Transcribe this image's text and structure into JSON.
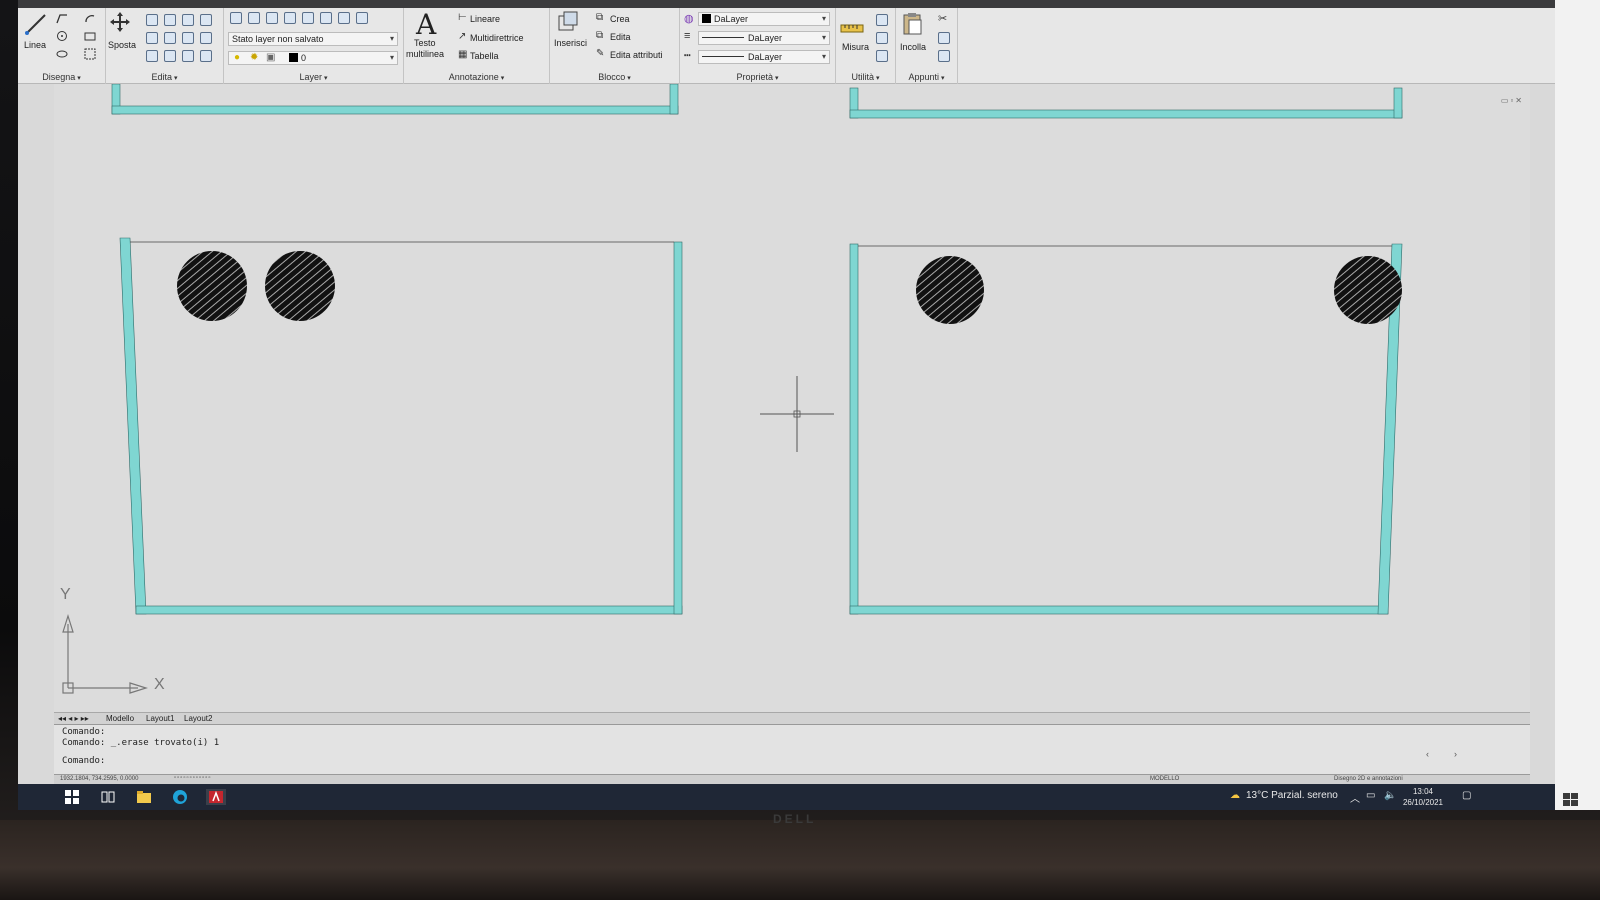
{
  "ribbon": {
    "panels": {
      "disegna": "Disegna",
      "edita": "Edita",
      "layer": "Layer",
      "annotazione": "Annotazione",
      "blocco": "Blocco",
      "proprieta": "Proprietà",
      "utilita": "Utilità",
      "appunti": "Appunti"
    },
    "tools": {
      "linea": "Linea",
      "sposta": "Sposta",
      "layer_state": "Stato layer non salvato",
      "layer_current": "0",
      "testo": "Testo",
      "multilinea": "multilinea",
      "lineare": "Lineare",
      "multidirettrice": "Multidirettrice",
      "tabella": "Tabella",
      "inserisci": "Inserisci",
      "crea": "Crea",
      "edita_block": "Edita",
      "edita_attributi": "Edita attributi",
      "color": "DaLayer",
      "lineweight": "DaLayer",
      "linetype": "DaLayer",
      "misura": "Misura",
      "incolla": "Incolla"
    }
  },
  "drawing": {
    "ucs_x": "X",
    "ucs_y": "Y",
    "stroke_color": "#7fd6d2"
  },
  "tabs": [
    "Modello",
    "Layout1",
    "Layout2"
  ],
  "command": {
    "line1": "Comando:",
    "line2": "Comando: _.erase trovato(i) 1",
    "prompt": "Comando:"
  },
  "status": {
    "coords": "1932.1804, 734.2595, 0.0000",
    "mode": "MODELLO",
    "workspace": "Disegno 2D e annotazioni"
  },
  "taskbar": {
    "weather": "13°C  Parzial. sereno",
    "time": "13:04",
    "date": "26/10/2021"
  },
  "monitor_brand": "DELL"
}
